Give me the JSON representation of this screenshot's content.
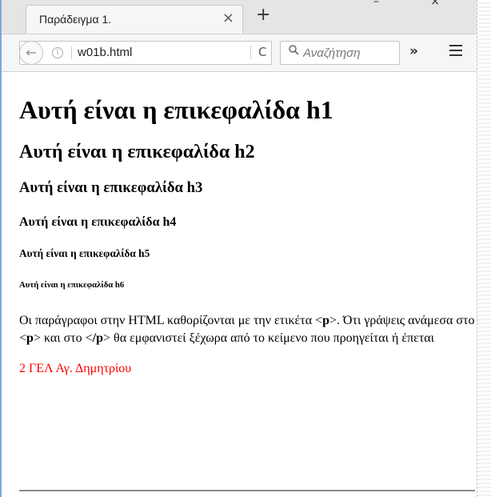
{
  "browser": {
    "tab_title": "Παράδειγμα 1.",
    "tab_close": "×",
    "new_tab": "+",
    "window_controls": "– ×",
    "back": "←",
    "info": "i",
    "url": "w01b.html",
    "reload": "C",
    "search_placeholder": "Αναζήτηση",
    "search_icon": "🔍",
    "overflow": "»"
  },
  "page": {
    "h1": "Αυτή είναι η επικεφαλίδα h1",
    "h2": "Αυτή είναι η επικεφαλίδα h2",
    "h3": "Αυτή είναι η επικεφαλίδα h3",
    "h4": "Αυτή είναι η επικεφαλίδα h4",
    "h5": "Αυτή είναι η επικεφαλίδα h5",
    "h6": "Αυτή είναι η επικεφαλίδα h6",
    "paragraph": {
      "part1": "Οι παράγραφοι στην HTML καθορίζονται με την ετικέτα <",
      "tag_p": "p",
      "part2": ">. Ότι γράψεις ανάμεσα στο <",
      "part3": "> και στο <",
      "tag_close_p": "/p",
      "part4": "> θα εμφανιστεί ξέχωρα από το κείμενο που προηγείται ή έπεται"
    },
    "school": "2 ΓΕΛ Αγ. Δημητρίου",
    "school_color": "#ff0000"
  }
}
